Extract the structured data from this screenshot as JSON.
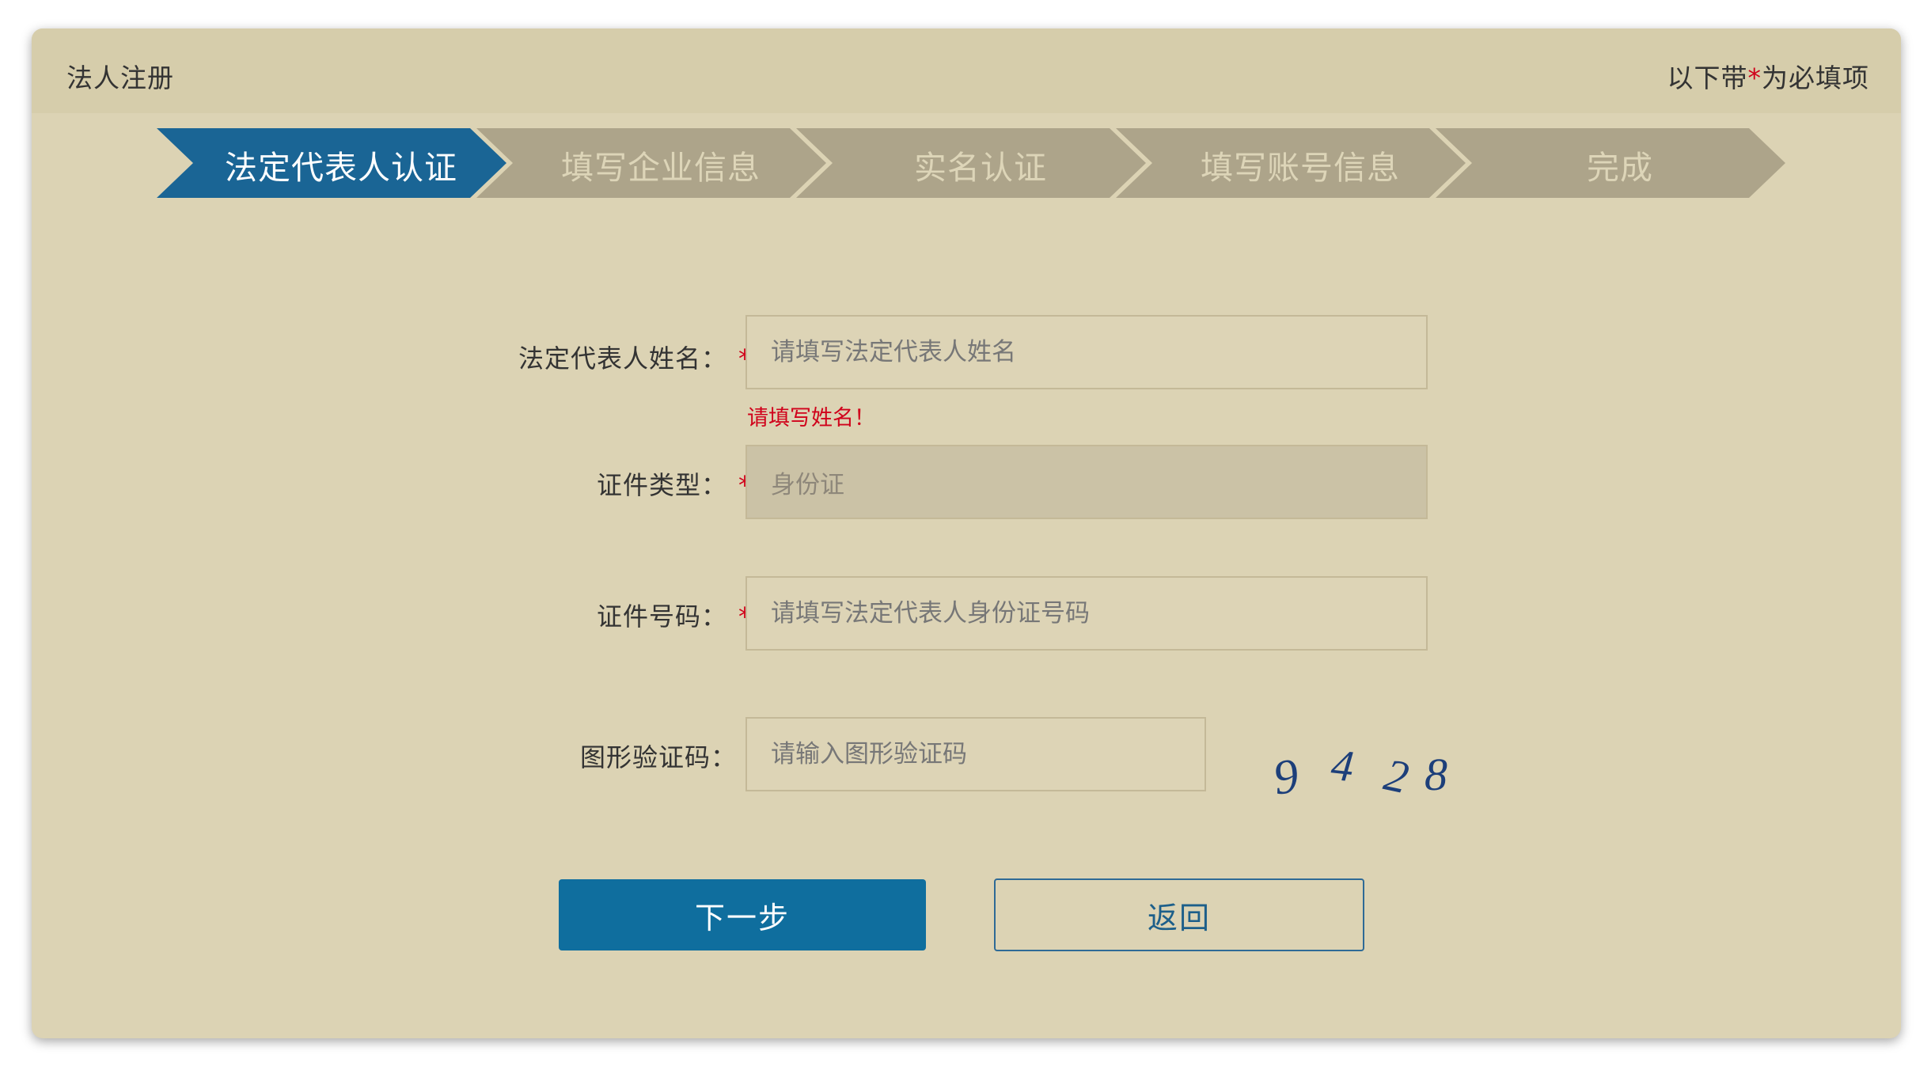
{
  "header": {
    "title": "法人注册",
    "note_prefix": "以下带",
    "note_star": "*",
    "note_suffix": "为必填项"
  },
  "steps": [
    {
      "label": "法定代表人认证",
      "active": true
    },
    {
      "label": "填写企业信息",
      "active": false
    },
    {
      "label": "实名认证",
      "active": false
    },
    {
      "label": "填写账号信息",
      "active": false
    },
    {
      "label": "完成",
      "active": false
    }
  ],
  "form": {
    "name": {
      "label": "法定代表人姓名：",
      "required": "*",
      "placeholder": "请填写法定代表人姓名",
      "error": "请填写姓名！"
    },
    "id_type": {
      "label": "证件类型：",
      "required": "*",
      "value": "身份证"
    },
    "id_number": {
      "label": "证件号码：",
      "required": "*",
      "placeholder": "请填写法定代表人身份证号码"
    },
    "captcha": {
      "label": "图形验证码：",
      "required": "*",
      "placeholder": "请输入图形验证码",
      "image_text": [
        "9",
        "4",
        "2",
        "8"
      ]
    }
  },
  "buttons": {
    "next": "下一步",
    "back": "返回"
  },
  "colors": {
    "background": "#dcd3b4",
    "header": "#d6cdab",
    "step_active": "#1a6595",
    "step_inactive": "#ada48a",
    "primary": "#0f6e9e",
    "required": "#d0021b",
    "captcha_ink": "#1d3f7a"
  }
}
